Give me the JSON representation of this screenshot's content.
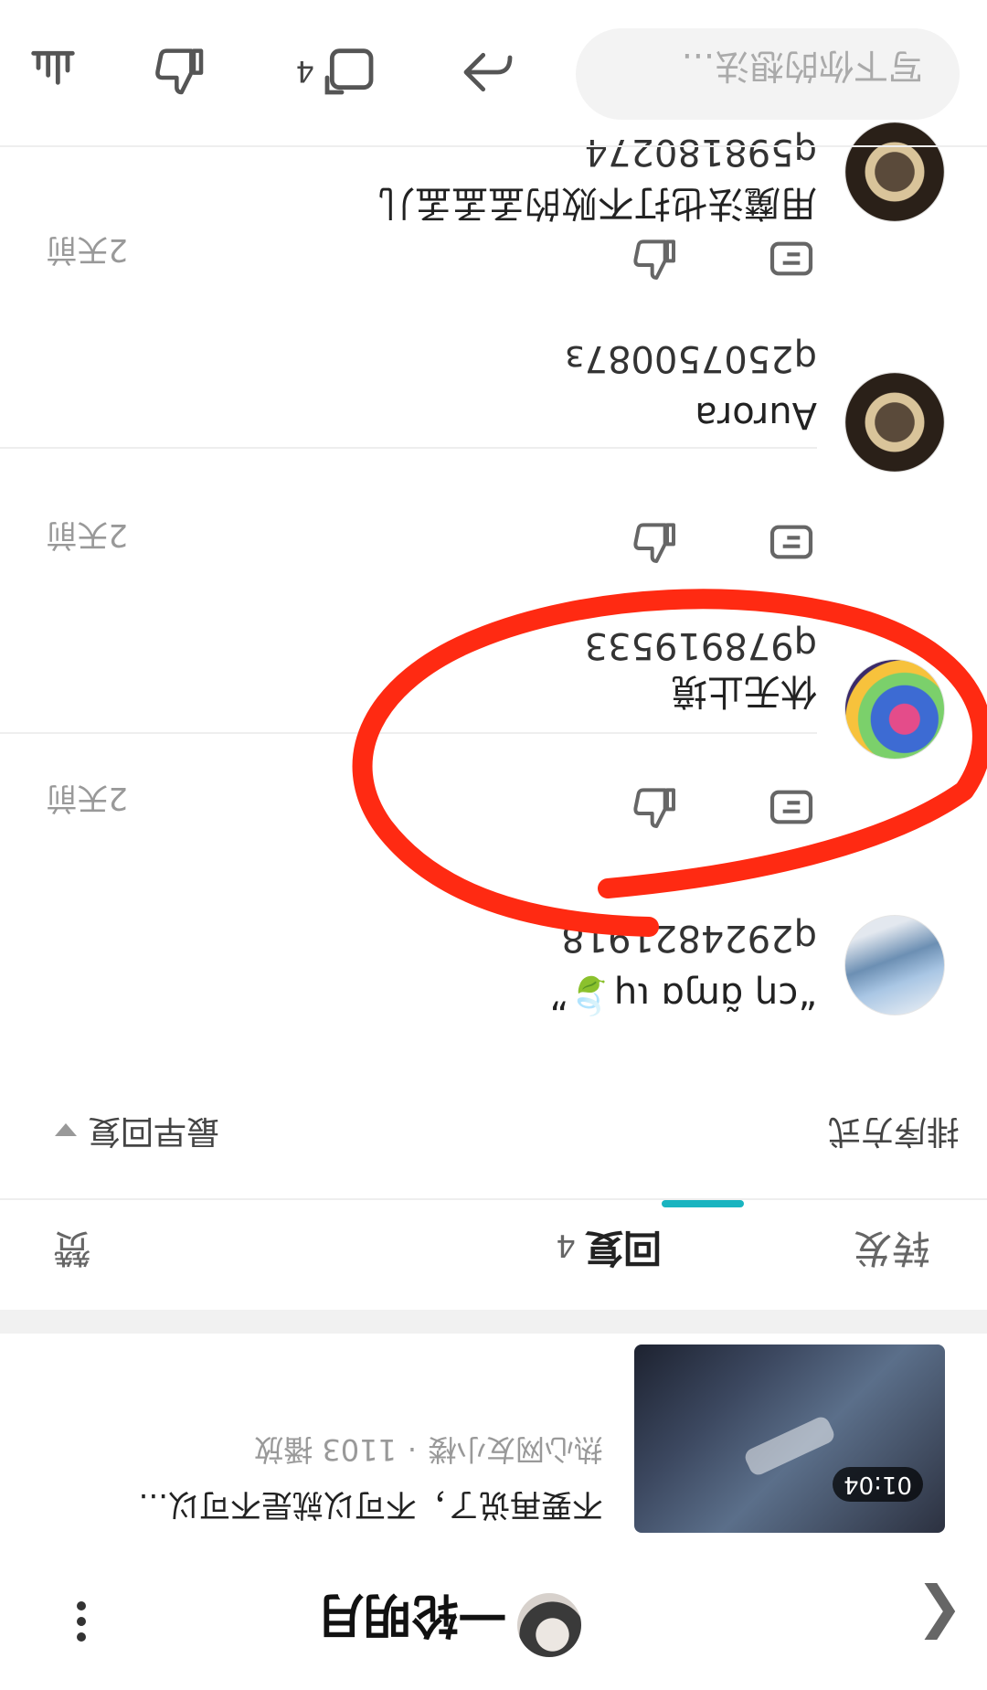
{
  "header": {
    "back_icon": "chevron-right-icon",
    "username": "一轮明月",
    "more_icon": "more-vertical-icon"
  },
  "video": {
    "duration": "01:04",
    "title": "不要再说了，不可以就是不可以...",
    "uploader": "热心网友小楼",
    "separator": "·",
    "plays": "1103 播放"
  },
  "tabs": {
    "forward": "转发",
    "reply": "回复",
    "reply_count": "4",
    "like": "赞",
    "accent": "#19b4c0"
  },
  "sort": {
    "label": "排序方式",
    "value": "最早回复"
  },
  "comments": [
    {
      "name": "“cη ɑ̃ɱɑ ɩɥ🍃”",
      "body": "q2924821918",
      "time": "2天前"
    },
    {
      "name": "休无止境",
      "body": "q978919533",
      "time": "2天前"
    },
    {
      "name": "Aurora",
      "body": "q250750087з",
      "time": "2天前"
    },
    {
      "name": "用魔法也打不败的孟孟孟儿",
      "body": "q598180274"
    }
  ],
  "action_bar": {
    "placeholder": "写下你的想法...",
    "repost_count": "4"
  },
  "annotation_color": "#ff2a12"
}
